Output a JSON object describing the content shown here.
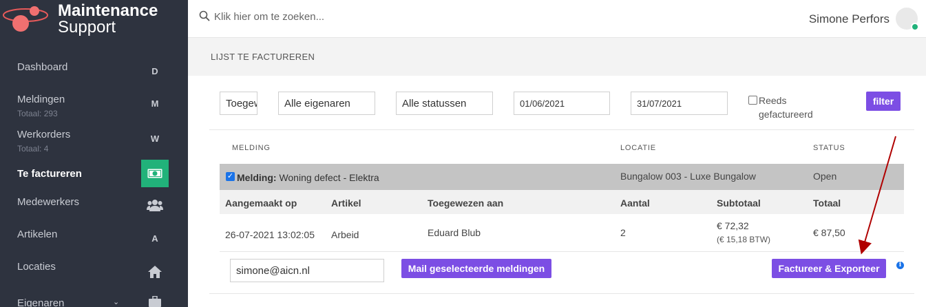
{
  "app": {
    "logo_line1": "Maintenance",
    "logo_line2": "Support"
  },
  "sidebar": {
    "items": [
      {
        "label": "Dashboard",
        "sub": "",
        "icon": "D",
        "icon_name": "letter-d-icon"
      },
      {
        "label": "Meldingen",
        "sub": "Totaal: 293",
        "icon": "M",
        "icon_name": "letter-m-icon"
      },
      {
        "label": "Werkorders",
        "sub": "Totaal: 4",
        "icon": "W",
        "icon_name": "letter-w-icon"
      },
      {
        "label": "Te factureren",
        "sub": "",
        "icon": "",
        "icon_name": "money-bill-icon"
      },
      {
        "label": "Medewerkers",
        "sub": "",
        "icon": "",
        "icon_name": "users-icon"
      },
      {
        "label": "Artikelen",
        "sub": "",
        "icon": "A",
        "icon_name": "letter-a-icon"
      },
      {
        "label": "Locaties",
        "sub": "",
        "icon": "",
        "icon_name": "home-icon"
      },
      {
        "label": "Eigenaren",
        "sub": "",
        "icon": "",
        "icon_name": "briefcase-icon"
      }
    ],
    "active_index": 3
  },
  "header": {
    "search_placeholder": "Klik hier om te zoeken...",
    "user_name": "Simone Perfors"
  },
  "page": {
    "title": "LIJST TE FACTUREREN"
  },
  "filters": {
    "assigned": "Toegewezen aan",
    "owners": "Alle eigenaren",
    "statuses": "Alle statussen",
    "date_from": "01/06/2021",
    "date_to": "31/07/2021",
    "invoiced_label": "Reeds gefactureerd",
    "invoiced_checked": false,
    "filter_button": "filter"
  },
  "table": {
    "headers": {
      "melding": "MELDING",
      "locatie": "LOCATIE",
      "status": "STATUS"
    },
    "group": {
      "checked": true,
      "prefix": "Melding:",
      "title": "Woning defect - Elektra",
      "location": "Bungalow 003 - Luxe Bungalow",
      "status": "Open"
    },
    "columns": {
      "created": "Aangemaakt op",
      "article": "Artikel",
      "assigned": "Toegewezen aan",
      "amount": "Aantal",
      "subtotal": "Subtotaal",
      "total": "Totaal"
    },
    "rows": [
      {
        "created": "26-07-2021 13:02:05",
        "article": "Arbeid",
        "assigned": "Eduard Blub",
        "amount": "2",
        "subtotal": "€ 72,32",
        "vat": "(€ 15,18 BTW)",
        "total": "€ 87,50"
      }
    ]
  },
  "actions": {
    "email": "simone@aicn.nl",
    "mail_button": "Mail geselecteerde meldingen",
    "export_button": "Factureer & Exporteer",
    "info_icon": "i"
  },
  "colors": {
    "sidebar_bg": "#2e333f",
    "accent_purple": "#7c4ee4",
    "active_green": "#21b27a",
    "annotation_arrow": "#b00000"
  }
}
